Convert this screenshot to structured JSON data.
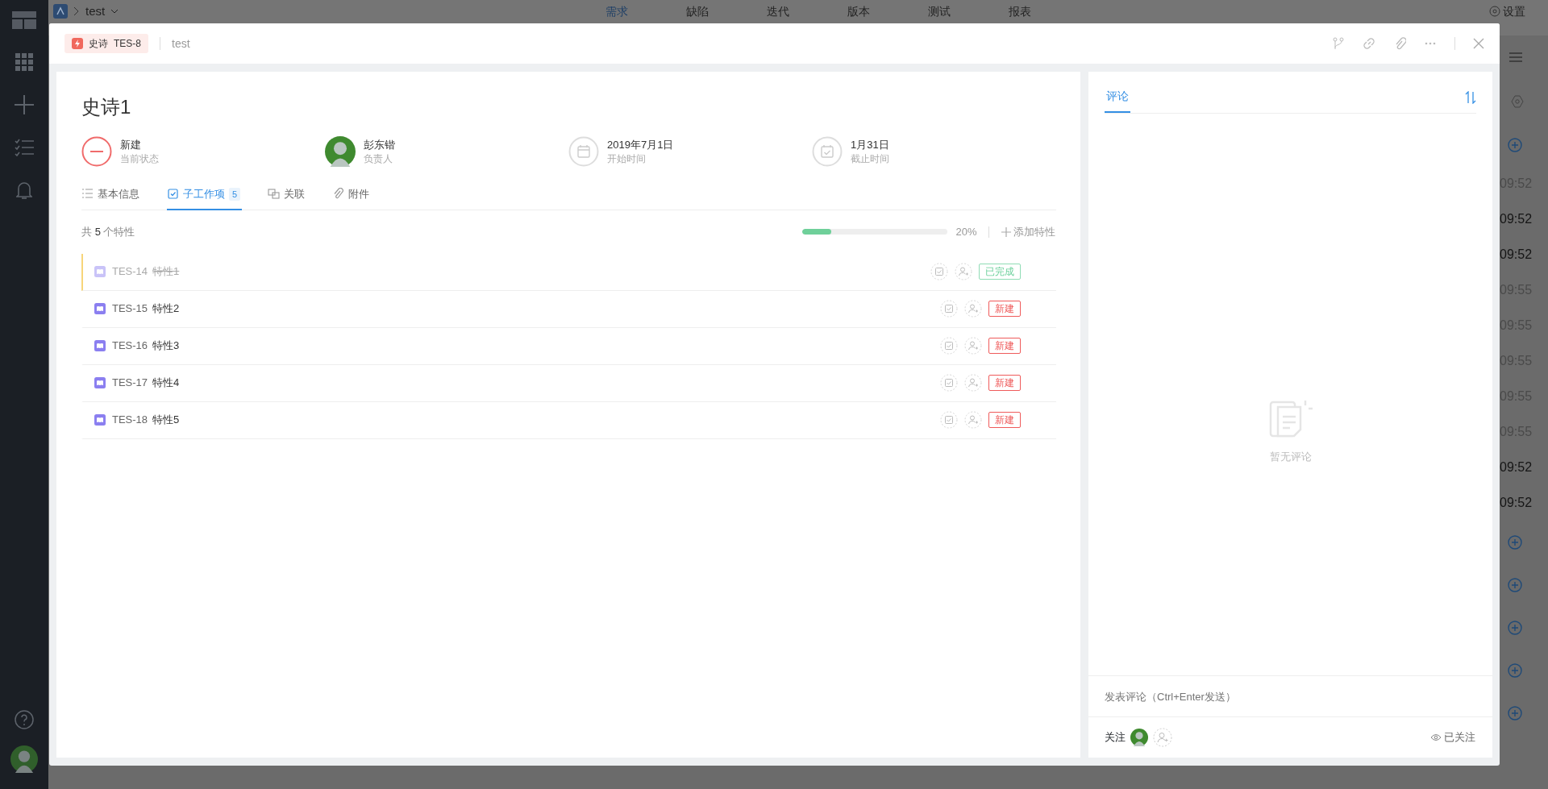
{
  "background": {
    "project": "test",
    "nav_tabs": [
      {
        "label": "需求",
        "selected": true
      },
      {
        "label": "缺陷",
        "selected": false
      },
      {
        "label": "迭代",
        "selected": false
      },
      {
        "label": "版本",
        "selected": false
      },
      {
        "label": "测试",
        "selected": false
      },
      {
        "label": "报表",
        "selected": false
      }
    ],
    "settings_label": "设置",
    "timeline": [
      {
        "kind": "add"
      },
      {
        "kind": "time",
        "time": "09:52",
        "dim": true
      },
      {
        "kind": "time",
        "time": "09:52",
        "dim": false
      },
      {
        "kind": "time",
        "time": "09:52",
        "dim": false
      },
      {
        "kind": "time",
        "time": "09:55",
        "dim": true
      },
      {
        "kind": "time",
        "time": "09:55",
        "dim": true
      },
      {
        "kind": "time",
        "time": "09:55",
        "dim": true
      },
      {
        "kind": "time",
        "time": "09:55",
        "dim": true
      },
      {
        "kind": "time",
        "time": "09:55",
        "dim": true
      },
      {
        "kind": "time",
        "time": "09:52",
        "dim": false
      },
      {
        "kind": "time",
        "time": "09:52",
        "dim": false
      },
      {
        "kind": "add"
      },
      {
        "kind": "add"
      },
      {
        "kind": "add"
      },
      {
        "kind": "add"
      },
      {
        "kind": "add"
      }
    ]
  },
  "modal": {
    "type_tag": {
      "label": "史诗",
      "key": "TES-8"
    },
    "project": "test",
    "title": "史诗1",
    "fields": [
      {
        "kind": "status",
        "value": "新建",
        "label": "当前状态"
      },
      {
        "kind": "assignee",
        "value": "彭东锴",
        "label": "负责人"
      },
      {
        "kind": "start",
        "value": "2019年7月1日",
        "label": "开始时间"
      },
      {
        "kind": "due",
        "value": "1月31日",
        "label": "截止时间"
      }
    ],
    "tabs": [
      {
        "kind": "info",
        "label": "基本信息",
        "selected": false
      },
      {
        "kind": "children",
        "label": "子工作项",
        "count": "5",
        "selected": true
      },
      {
        "kind": "links",
        "label": "关联",
        "selected": false
      },
      {
        "kind": "files",
        "label": "附件",
        "selected": false
      }
    ],
    "summary": {
      "prefix": "共",
      "count": "5",
      "suffix": "个特性"
    },
    "progress": {
      "level": 0.2,
      "reading": "20%"
    },
    "add_label": "添加特性",
    "items": [
      {
        "key": "TES-14",
        "title": "特性1",
        "done": true,
        "highlighted": true,
        "status": "已完成",
        "kind": "done"
      },
      {
        "key": "TES-15",
        "title": "特性2",
        "done": false,
        "highlighted": false,
        "status": "新建",
        "kind": "new"
      },
      {
        "key": "TES-16",
        "title": "特性3",
        "done": false,
        "highlighted": false,
        "status": "新建",
        "kind": "new"
      },
      {
        "key": "TES-17",
        "title": "特性4",
        "done": false,
        "highlighted": false,
        "status": "新建",
        "kind": "new"
      },
      {
        "key": "TES-18",
        "title": "特性5",
        "done": false,
        "highlighted": false,
        "status": "新建",
        "kind": "new"
      }
    ],
    "comments": {
      "tab": "评论",
      "selected": true,
      "empty_text": "暂无评论",
      "placeholder": "发表评论（Ctrl+Enter发送）",
      "follow_label": "关注",
      "followed_label": "已关注"
    }
  }
}
